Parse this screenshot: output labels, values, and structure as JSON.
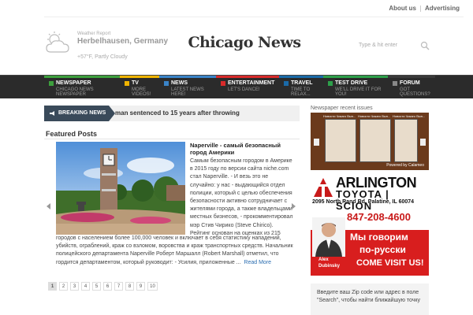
{
  "toplinks": {
    "about": "About us",
    "advertising": "Advertising"
  },
  "weather": {
    "label": "Weather Report",
    "city": "Herbelhausen, Germany",
    "condition": "+57°F, Partly Cloudy",
    "icon": "cloud-icon"
  },
  "logo": {
    "text": "Chicago News"
  },
  "search": {
    "placeholder": "Type & hit enter",
    "icon": "search-icon"
  },
  "nav": [
    {
      "title": "NEWSPAPER",
      "sub": "CHICAGO NEWS NEWSPAPER",
      "color": "#3da03d"
    },
    {
      "title": "TV",
      "sub": "MORE VIDEOS!",
      "color": "#f0b400"
    },
    {
      "title": "NEWS",
      "sub": "LATEST NEWS HERE!",
      "color": "#3a84c8"
    },
    {
      "title": "ENTERTAINMENT",
      "sub": "LET'S DANCE!",
      "color": "#d82a2a"
    },
    {
      "title": "TRAVEL",
      "sub": "TIME TO RELAX...",
      "color": "#1a6aa8"
    },
    {
      "title": "TEST DRIVE",
      "sub": "WE'LL DRIVE IT FOR YOU!",
      "color": "#2da04a"
    },
    {
      "title": "FORUM",
      "sub": "GOT QUESTIONS?",
      "color": "#3a3a3a"
    }
  ],
  "breaking": {
    "label": "BREAKING NEWS",
    "text": "man sentenced to 15 years after throwing"
  },
  "featured": {
    "heading": "Featured Posts",
    "title": "Naperville - самый безопасный город Америки",
    "body": "Самым безопасным городом в Америке в 2015 году по версии сайта niche.com стал Naperville. - И везь это не случайно: у нас - выдающийся отдел полиции, который с целью обеспечения безопасности активно сотрудничает с жителями города, а также владельцами местных бизнесов, - прокомментировал мэр Стив Чирико (Steve Chirico). Рейтинг основан на оценках из 215",
    "body2": "городов с населением более 100,000 человек и включает в себя статистику нападений, убийств, ограблений, краж со взломом, воровства и краж транспортных средств. Начальник полицейского департамента Naperville Роберт Маршалл (Robert Marshall) отметил, что гордится департаментом, который руководит: - Усилия, приложенные ...",
    "read_more": "Read More"
  },
  "pager": [
    "1",
    "2",
    "3",
    "4",
    "5",
    "6",
    "7",
    "8",
    "9",
    "10"
  ],
  "sidebar": {
    "issues_heading": "Newspaper recent issues",
    "mag1_title": "Новости Чикаго Вып...",
    "mag1_date": "2015-09-22",
    "mag2_title": "Новости Чикаго Вып...",
    "mag2_date": "2015-09-15",
    "mag3_title": "Новости Чикаго Вып...",
    "mag3_date": "2015-09-08",
    "powered": "Powered by Calameo",
    "ad_name": "ARLINGTON",
    "ad_brand": "TOYOTA | SCION",
    "ad_address": "2095 North Rand Rd. Palatine, IL 60074",
    "ad_phone": "847-208-4600",
    "ad_ru1": "Мы говорим",
    "ad_ru2": "по-русски",
    "ad_visit": "COME VISIT US!",
    "ad_person": "Alex Dubinsky",
    "zip_text": "Введите ваш Zip code или адрес в поле \"Search\", чтобы найти ближайшую точку"
  }
}
